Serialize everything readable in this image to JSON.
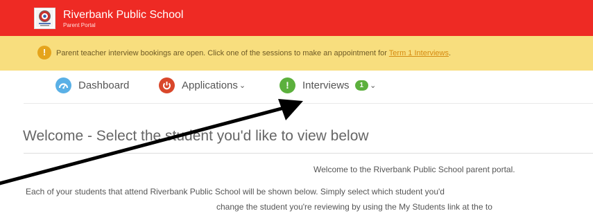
{
  "header": {
    "school_name": "Riverbank Public School",
    "portal_label": "Parent Portal",
    "brand_color": "#ee2a24"
  },
  "alert": {
    "icon": "exclamation-icon",
    "message": "Parent teacher interview bookings are open. Click one of the sessions to make an appointment for ",
    "link_text": "Term 1 Interviews",
    "link_suffix": ".",
    "background_color": "#f8de7e"
  },
  "nav": {
    "items": [
      {
        "label": "Dashboard",
        "icon": "dashboard-icon",
        "icon_color": "#5ab0e6"
      },
      {
        "label": "Applications",
        "icon": "power-icon",
        "icon_color": "#d9472b"
      },
      {
        "label": "Interviews",
        "icon": "exclamation-icon",
        "icon_color": "#5cb03d",
        "badge": "1"
      }
    ]
  },
  "main": {
    "title": "Welcome - Select the student you'd like to view below",
    "intro": "Welcome to the Riverbank Public School parent portal.",
    "paragraph_line1": "Each of your students that attend Riverbank Public School will be shown below. Simply select which student you'd",
    "paragraph_line2": "change the student you're reviewing by using the My Students link at the to"
  }
}
